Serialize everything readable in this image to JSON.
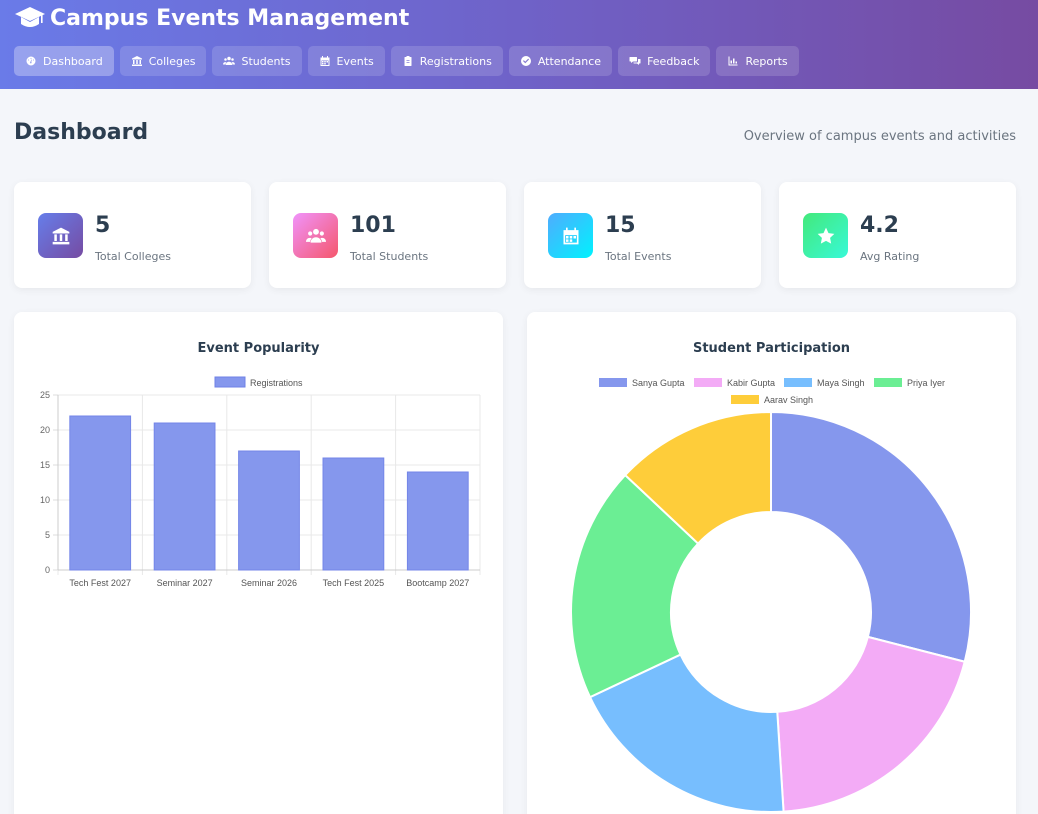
{
  "app": {
    "title": "Campus Events Management",
    "icon": "graduation-cap-icon"
  },
  "nav": [
    {
      "label": "Dashboard",
      "icon": "tachometer-icon",
      "active": true
    },
    {
      "label": "Colleges",
      "icon": "university-icon",
      "active": false
    },
    {
      "label": "Students",
      "icon": "users-icon",
      "active": false
    },
    {
      "label": "Events",
      "icon": "calendar-icon",
      "active": false
    },
    {
      "label": "Registrations",
      "icon": "clipboard-icon",
      "active": false
    },
    {
      "label": "Attendance",
      "icon": "check-circle-icon",
      "active": false
    },
    {
      "label": "Feedback",
      "icon": "comments-icon",
      "active": false
    },
    {
      "label": "Reports",
      "icon": "chart-icon",
      "active": false
    }
  ],
  "page": {
    "title": "Dashboard",
    "subtitle": "Overview of campus events and activities"
  },
  "stats": [
    {
      "value": "5",
      "label": "Total Colleges",
      "icon": "university-icon",
      "gradient": [
        "#667eea",
        "#764ba2"
      ]
    },
    {
      "value": "101",
      "label": "Total Students",
      "icon": "users-icon",
      "gradient": [
        "#f093fb",
        "#f5576c"
      ]
    },
    {
      "value": "15",
      "label": "Total Events",
      "icon": "calendar-icon",
      "gradient": [
        "#4facfe",
        "#00f2fe"
      ]
    },
    {
      "value": "4.2",
      "label": "Avg Rating",
      "icon": "star-icon",
      "gradient": [
        "#43e97b",
        "#38f9d7"
      ]
    }
  ],
  "charts": {
    "popularity_title": "Event Popularity",
    "participation_title": "Student Participation"
  },
  "chart_data": [
    {
      "type": "bar",
      "title": "Event Popularity",
      "categories": [
        "Tech Fest 2027",
        "Seminar 2027",
        "Seminar 2026",
        "Tech Fest 2025",
        "Bootcamp 2027"
      ],
      "series": [
        {
          "name": "Registrations",
          "values": [
            22,
            21,
            17,
            16,
            14
          ],
          "color": "#8597ed"
        }
      ],
      "ylim": [
        0,
        25
      ],
      "yticks": [
        0,
        5,
        10,
        15,
        20,
        25
      ],
      "grid": true,
      "legend": "top"
    },
    {
      "type": "pie",
      "variant": "doughnut",
      "title": "Student Participation",
      "labels": [
        "Sanya Gupta",
        "Kabir Gupta",
        "Maya Singh",
        "Priya Iyer",
        "Aarav Singh"
      ],
      "values": [
        29,
        20,
        19,
        19,
        13
      ],
      "colors": [
        "#8597ed",
        "#f3abf6",
        "#77befe",
        "#6bee94",
        "#fecd3a"
      ],
      "legend": "top"
    }
  ]
}
